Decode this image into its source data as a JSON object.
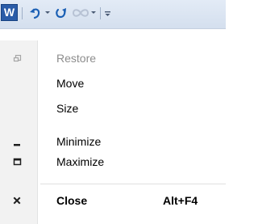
{
  "titlebar": {
    "app_icon_letter": "W",
    "quick_access": [
      {
        "name": "undo",
        "icon": "undo-icon"
      },
      {
        "name": "redo",
        "icon": "redo-icon"
      },
      {
        "name": "repeat",
        "icon": "repeat-icon"
      },
      {
        "name": "customize",
        "icon": "customize-quick-access-icon"
      }
    ]
  },
  "system_menu": {
    "items": [
      {
        "label": "Restore",
        "icon": "restore-icon",
        "enabled": false
      },
      {
        "label": "Move",
        "icon": "",
        "enabled": true
      },
      {
        "label": "Size",
        "icon": "",
        "enabled": true
      },
      {
        "label": "Minimize",
        "icon": "minimize-icon",
        "enabled": true
      },
      {
        "label": "Maximize",
        "icon": "maximize-icon",
        "enabled": true
      },
      {
        "label": "Close",
        "icon": "close-icon",
        "enabled": true,
        "bold": true,
        "shortcut": "Alt+F4"
      }
    ]
  },
  "colors": {
    "titlebar_bg": "#dbe4f1",
    "app_icon_bg": "#2a5ca8",
    "undo_color": "#1a5fb4",
    "redo_color": "#1a5fb4",
    "disabled_text": "#8d8d8d",
    "gutter_bg": "#f2f2f2"
  }
}
